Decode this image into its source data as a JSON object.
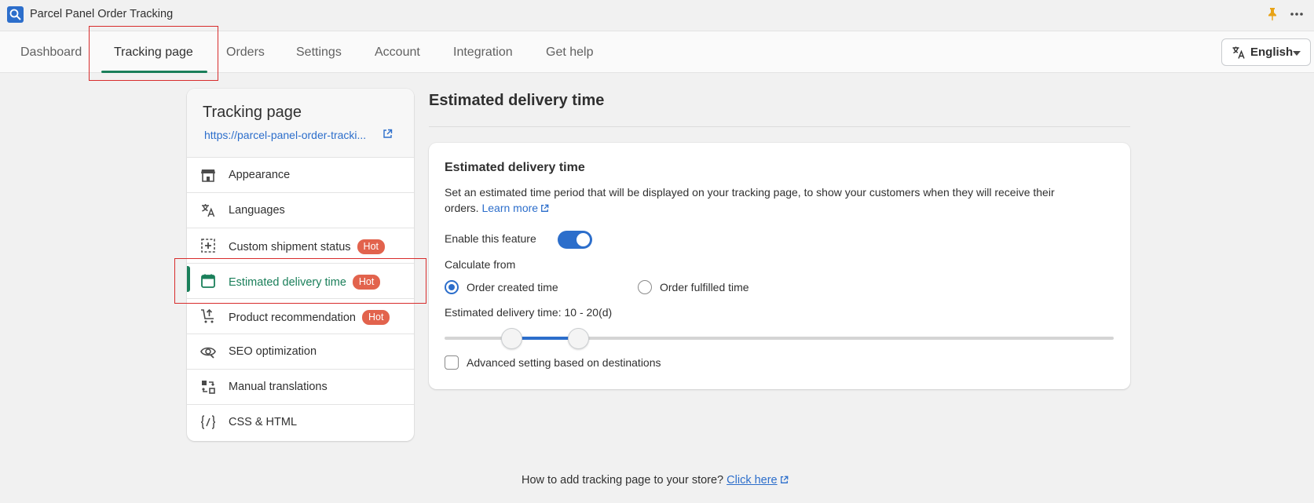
{
  "app": {
    "title": "Parcel Panel Order Tracking"
  },
  "nav": {
    "tabs": [
      {
        "label": "Dashboard"
      },
      {
        "label": "Tracking page"
      },
      {
        "label": "Orders"
      },
      {
        "label": "Settings"
      },
      {
        "label": "Account"
      },
      {
        "label": "Integration"
      },
      {
        "label": "Get help"
      }
    ],
    "active_tab": "Tracking page",
    "language": "English"
  },
  "sidebar": {
    "title": "Tracking page",
    "url": "https://parcel-panel-order-tracki...",
    "items": [
      {
        "label": "Appearance",
        "icon": "storefront-icon"
      },
      {
        "label": "Languages",
        "icon": "translate-icon"
      },
      {
        "label": "Custom shipment status",
        "icon": "dashed-box-plus-icon",
        "badge": "Hot"
      },
      {
        "label": "Estimated delivery time",
        "icon": "calendar-icon",
        "badge": "Hot",
        "active": true
      },
      {
        "label": "Product recommendation",
        "icon": "cart-up-icon",
        "badge": "Hot"
      },
      {
        "label": "SEO optimization",
        "icon": "eye-icon"
      },
      {
        "label": "Manual translations",
        "icon": "swap-icon"
      },
      {
        "label": "CSS & HTML",
        "icon": "code-braces-icon"
      }
    ]
  },
  "main": {
    "page_title": "Estimated delivery time",
    "card": {
      "title": "Estimated delivery time",
      "description": "Set an estimated time period that will be displayed on your tracking page, to show your customers when they will receive their orders.",
      "learn_more": "Learn more",
      "enable_label": "Enable this feature",
      "enable_on": true,
      "calculate_label": "Calculate from",
      "radio_options": [
        "Order created time",
        "Order fulfilled time"
      ],
      "radio_selected": "Order created time",
      "range_label": "Estimated delivery time: 10 - 20(d)",
      "range_min": 10,
      "range_max": 20,
      "advanced_label": "Advanced setting based on destinations",
      "advanced_checked": false
    }
  },
  "footer": {
    "question": "How to add tracking page to your store?",
    "link": "Click here"
  },
  "colors": {
    "accent": "#2c6ecb",
    "active_green": "#1a7f5a",
    "hot_badge": "#e2634d",
    "highlight_red": "#d82c2c"
  }
}
